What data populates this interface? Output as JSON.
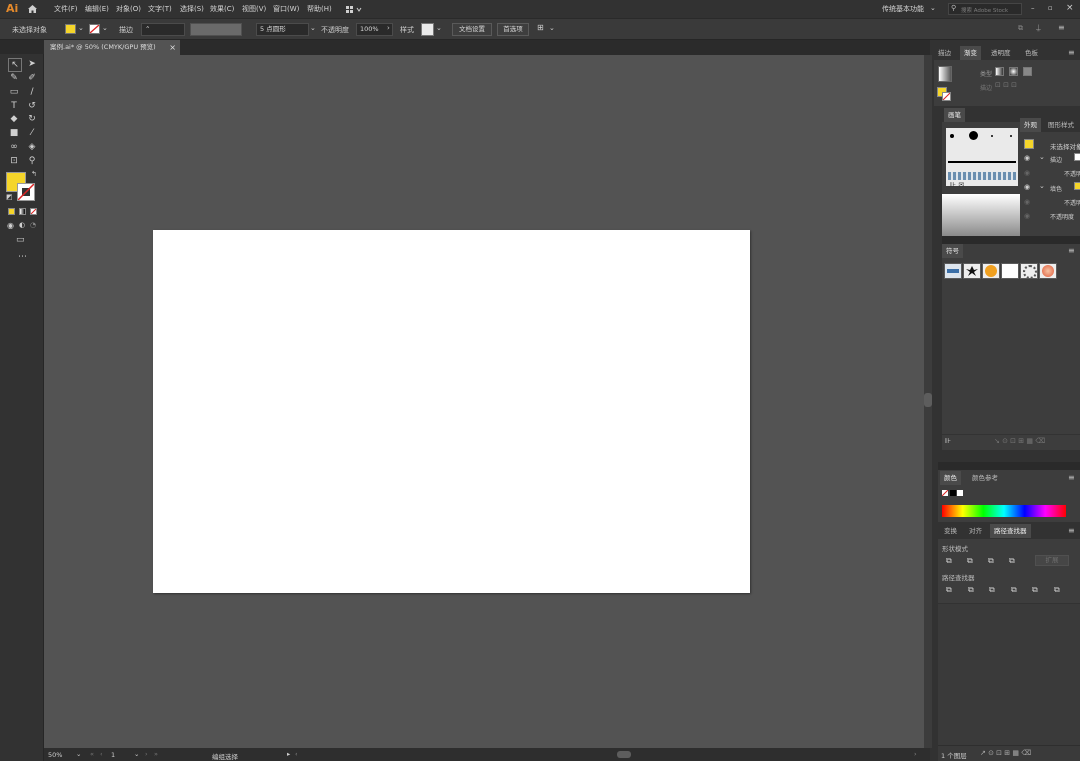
{
  "app": {
    "logo": "Ai",
    "home_icon": "home-icon"
  },
  "menubar": {
    "items": [
      "文件(F)",
      "编辑(E)",
      "对象(O)",
      "文字(T)",
      "选择(S)",
      "效果(C)",
      "视图(V)",
      "窗口(W)",
      "帮助(H)"
    ],
    "workspace": "传统基本功能",
    "search_placeholder": "搜索 Adobe Stock"
  },
  "control_bar": {
    "selection": "未选择对象",
    "stroke_label": "描边",
    "brush": "5 点圆形",
    "opacity_label": "不透明度",
    "opacity_value": "100%",
    "style_label": "样式",
    "doc_setup": "文档设置",
    "preferences": "首选项"
  },
  "document": {
    "tab_label": "案例.ai* @ 50% (CMYK/GPU 预览)",
    "close": "×"
  },
  "status": {
    "zoom": "50%",
    "page": "1",
    "tool": "编组选择"
  },
  "colors": {
    "fill": "#f5d52a",
    "artboard": "#ffffff",
    "workspace": "#535353"
  },
  "panels": {
    "top_tabs": [
      "描边",
      "渐变",
      "透明度",
      "色板"
    ],
    "gradient_type_label": "类型",
    "gradient_row2_label": "描边",
    "brushes_title": "画笔",
    "appearance_tabs": [
      "外观",
      "图形样式"
    ],
    "appearance_rows": [
      "未选择对象",
      "描边",
      "不透明度",
      "填色",
      "不透明度",
      "不透明度"
    ],
    "symbols_title": "符号",
    "color_tabs": [
      "颜色",
      "颜色参考"
    ],
    "pathfinder_tabs": [
      "变换",
      "对齐",
      "路径查找器"
    ],
    "shape_modes_label": "形状模式",
    "expand_label": "扩展",
    "pathfinders_label": "路径查找器",
    "layers_count": "1 个图层"
  }
}
